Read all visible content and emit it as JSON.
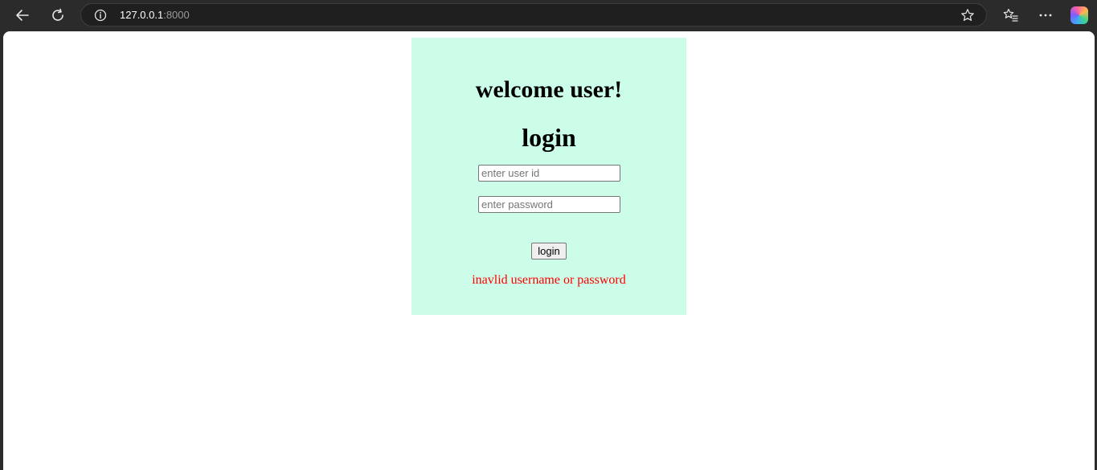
{
  "browser": {
    "address": {
      "host": "127.0.0.1",
      "port": ":8000"
    },
    "icons": {
      "back": "back-arrow-icon",
      "reload": "reload-icon",
      "info": "info-icon",
      "favorite": "star-icon",
      "favorites_list": "favorites-icon",
      "menu": "more-icon",
      "copilot": "copilot-icon"
    }
  },
  "page": {
    "welcome": "welcome user!",
    "title": "login",
    "user_field": {
      "placeholder": "enter user id",
      "value": ""
    },
    "password_field": {
      "placeholder": "enter password",
      "value": ""
    },
    "login_button": "login",
    "error": "inavlid username or password",
    "colors": {
      "card_background": "#ccfde8",
      "error_text": "#ff0000"
    }
  }
}
